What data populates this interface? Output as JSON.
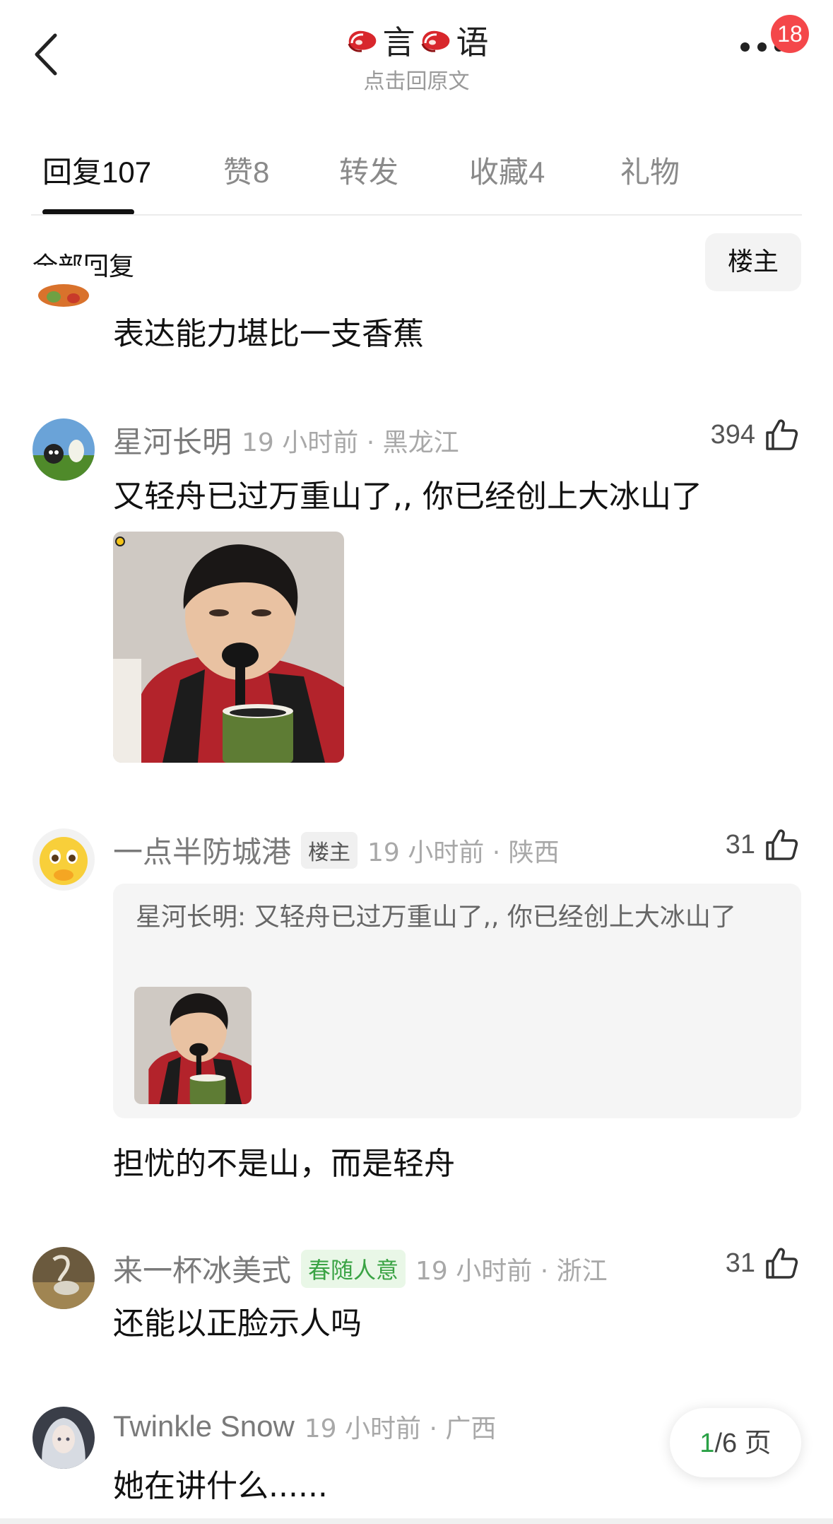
{
  "header": {
    "title_part1": "言",
    "title_part2": "语",
    "subtitle": "点击回原文",
    "notification_count": "18",
    "icons": {
      "back": "back-chevron-icon",
      "more": "more-dots-icon",
      "title_emoji": "steak-icon"
    }
  },
  "tabs": [
    {
      "label": "回复",
      "count": "107",
      "active": true
    },
    {
      "label": "赞",
      "count": "8",
      "active": false
    },
    {
      "label": "转发",
      "count": "",
      "active": false
    },
    {
      "label": "收藏",
      "count": "4",
      "active": false
    },
    {
      "label": "礼物",
      "count": "",
      "active": false
    }
  ],
  "section": {
    "title": "全部回复",
    "filter_button": "楼主"
  },
  "comments": [
    {
      "text": "表达能力堪比一支香蕉"
    },
    {
      "username": "星河长明",
      "time": "19 小时前 · 黑龙江",
      "likes": "394",
      "text": "又轻舟已过万重山了,, 你已经创上大冰山了"
    },
    {
      "username": "一点半防城港",
      "owner_tag": "楼主",
      "time": "19 小时前 · 陕西",
      "likes": "31",
      "quote_text": "星河长明: 又轻舟已过万重山了,, 你已经创上大冰山了",
      "text": "担忧的不是山，而是轻舟"
    },
    {
      "username": "来一杯冰美式",
      "badge": "春随人意",
      "time": "19 小时前 · 浙江",
      "likes": "31",
      "text": "还能以正脸示人吗"
    },
    {
      "username": "Twinkle Snow",
      "time": "19 小时前 · 广西",
      "text": "她在讲什么......"
    }
  ],
  "pager": {
    "current": "1",
    "total": "/6 页"
  },
  "colors": {
    "accent_green": "#2aa146",
    "badge_red": "#f4474a",
    "tag_green": "#3aa344"
  }
}
